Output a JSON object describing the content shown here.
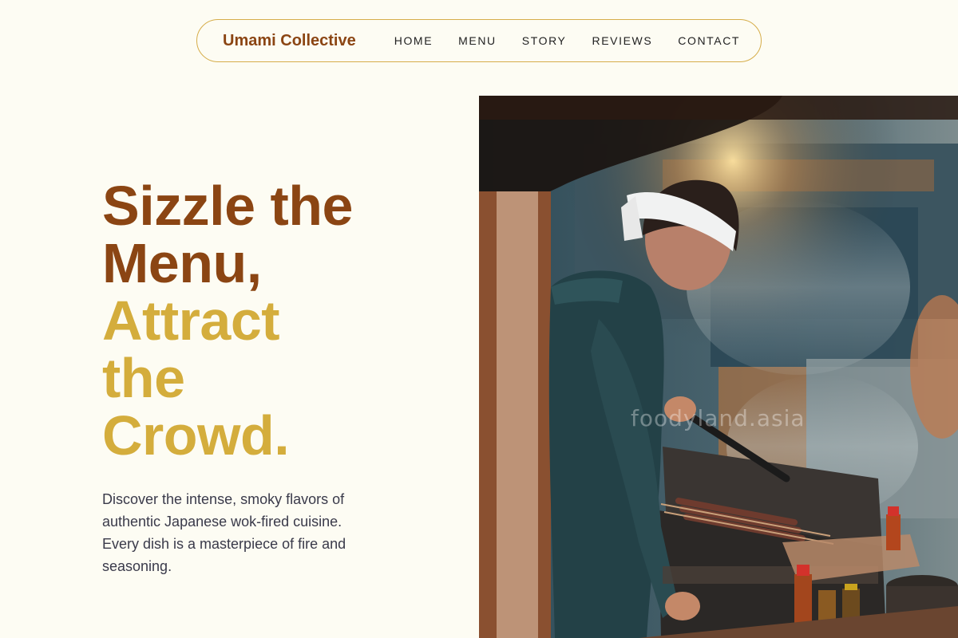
{
  "nav": {
    "brand": "Umami Collective",
    "links": [
      "HOME",
      "MENU",
      "STORY",
      "REVIEWS",
      "CONTACT"
    ]
  },
  "hero": {
    "headline_line1": "Sizzle the",
    "headline_line2": "Menu,",
    "headline_line3": "Attract",
    "headline_line4": "the",
    "headline_line5": "Crowd.",
    "description": "Discover the intense, smoky flavors of authentic Japanese wok-fired cuisine. Every dish is a masterpiece of fire and seasoning.",
    "image_watermark": "foodyland.asia"
  },
  "colors": {
    "background": "#fdfcf3",
    "brand": "#8b4513",
    "accent_gold": "#d4ad3c",
    "nav_border": "#d6ad4a",
    "body_text": "#3a3a4a"
  }
}
